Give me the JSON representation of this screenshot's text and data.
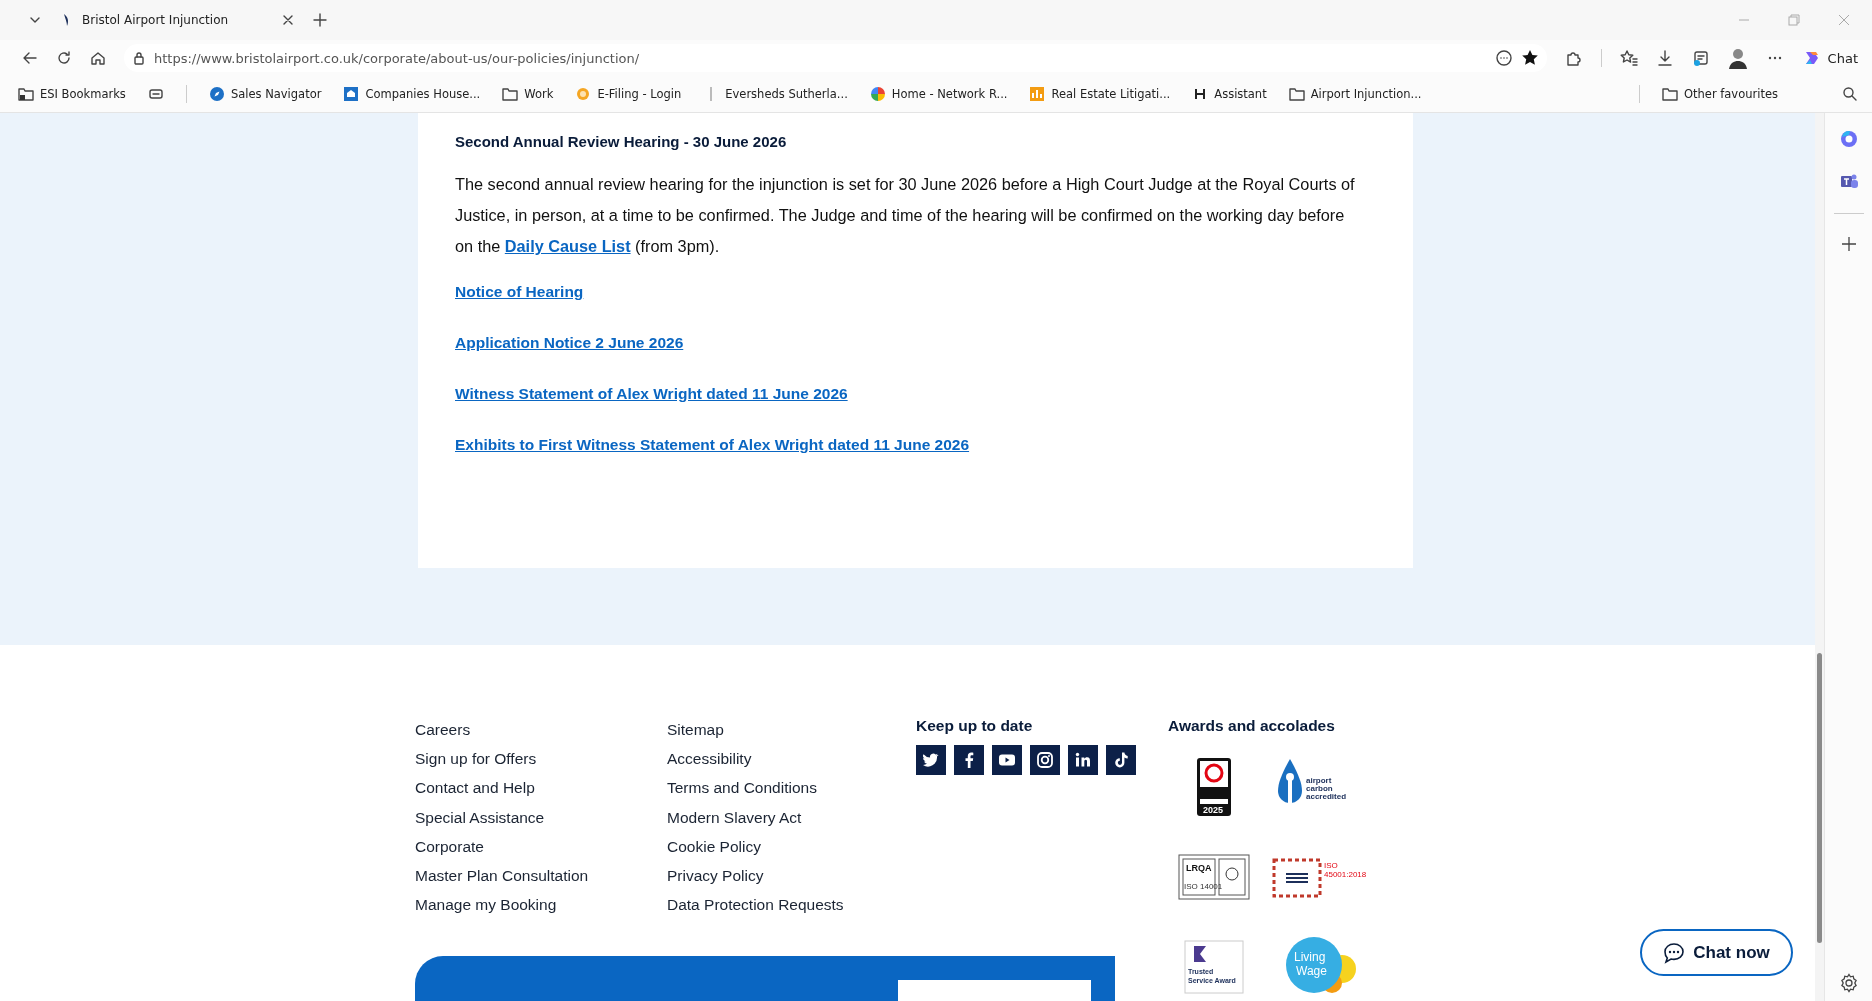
{
  "browser": {
    "tab_title": "Bristol Airport Injunction",
    "url": "https://www.bristolairport.co.uk/corporate/about-us/our-policies/injunction/",
    "chat_label": "Chat",
    "bookmarks": [
      {
        "kind": "folder-lock",
        "label": "ESI Bookmarks"
      },
      {
        "kind": "device"
      },
      {
        "kind": "compass",
        "label": "Sales Navigator"
      },
      {
        "kind": "crest",
        "label": "Companies House..."
      },
      {
        "kind": "folder",
        "label": "Work"
      },
      {
        "kind": "sun",
        "label": "E-Filing - Login"
      },
      {
        "kind": "bar",
        "label": "Eversheds Sutherla..."
      },
      {
        "kind": "pinwheel",
        "label": "Home - Network R..."
      },
      {
        "kind": "chart",
        "label": "Real Estate Litigati..."
      },
      {
        "kind": "letter",
        "label": "Assistant"
      },
      {
        "kind": "folder",
        "label": "Airport Injunction..."
      }
    ],
    "other_favourites": "Other favourites"
  },
  "article": {
    "heading": "Second Annual Review Hearing - 30 June 2026",
    "paragraph": {
      "before": "The second annual review hearing for the injunction is set for 30 June 2026 before a High Court Judge at the Royal Courts of Justice, in person, at a time to be confirmed. The Judge and time of the hearing will be confirmed on the working day before on the ",
      "link": "Daily Cause List",
      "after": " (from 3pm)."
    },
    "links": [
      "Notice of Hearing",
      "Application Notice 2 June 2026",
      "Witness Statement of Alex Wright dated 11 June 2026",
      "Exhibits to First Witness Statement of Alex Wright dated 11 June 2026"
    ]
  },
  "footer": {
    "columns": [
      [
        "Careers",
        "Sign up for Offers",
        "Contact and Help",
        "Special Assistance",
        "Corporate",
        "Master Plan Consultation",
        "Manage my Booking"
      ],
      [
        "Sitemap",
        "Accessibility",
        "Terms and Conditions",
        "Modern Slavery Act",
        "Cookie Policy",
        "Privacy Policy",
        "Data Protection Requests"
      ]
    ],
    "social_heading": "Keep up to date",
    "social": [
      {
        "kind": "twitter"
      },
      {
        "kind": "facebook"
      },
      {
        "kind": "youtube"
      },
      {
        "kind": "instagram"
      },
      {
        "kind": "linkedin"
      },
      {
        "kind": "tiktok"
      }
    ],
    "awards_heading": "Awards and accolades",
    "awards": [
      {
        "kind": "best-companies",
        "text": [
          "2025"
        ]
      },
      {
        "kind": "carbon",
        "text": [
          "airport",
          "carbon",
          "accredited"
        ]
      },
      {
        "kind": "lrqa",
        "text": [
          "LRQA",
          "ISO 14001"
        ]
      },
      {
        "kind": "safety",
        "text": [
          "ISO",
          "45001:2018"
        ]
      },
      {
        "kind": "feefo",
        "text": [
          "Trusted",
          "Service Award"
        ]
      },
      {
        "kind": "living-wage",
        "text": [
          "Living",
          "Wage"
        ]
      }
    ]
  },
  "chat_button": "Chat now"
}
